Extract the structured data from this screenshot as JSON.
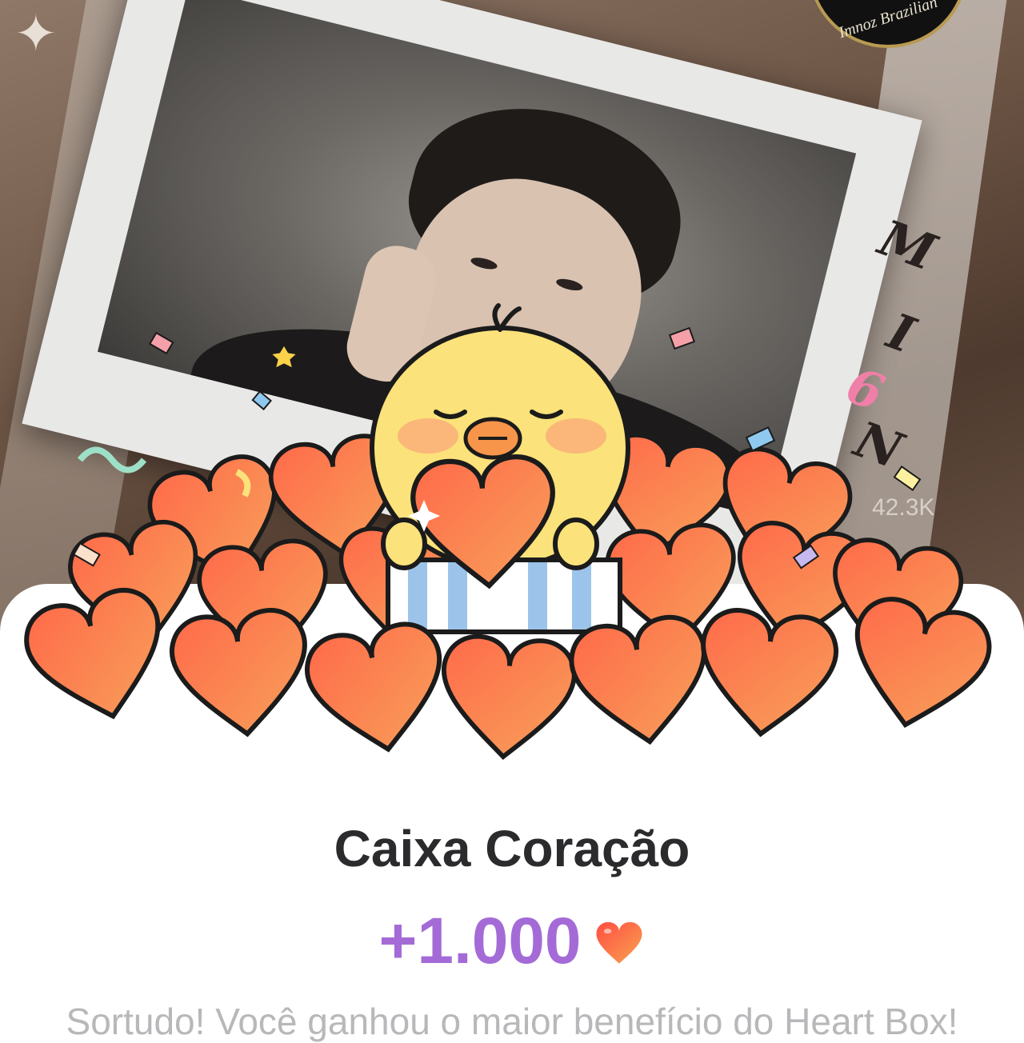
{
  "background": {
    "seal_text": "Imnoz Brazilian",
    "script_letters": [
      "M",
      "I",
      "6",
      "N"
    ],
    "like_count": "42.3K"
  },
  "sheet": {
    "title": "Caixa Coração",
    "reward_amount": "+1.000",
    "reward_icon": "heart-icon",
    "description": "Sortudo! Você ganhou o maior benefício do Heart Box!"
  },
  "colors": {
    "reward": "#a46bd7",
    "title": "#2b2b2d",
    "heart": "#f2573f",
    "description": "#b8b8bb"
  }
}
